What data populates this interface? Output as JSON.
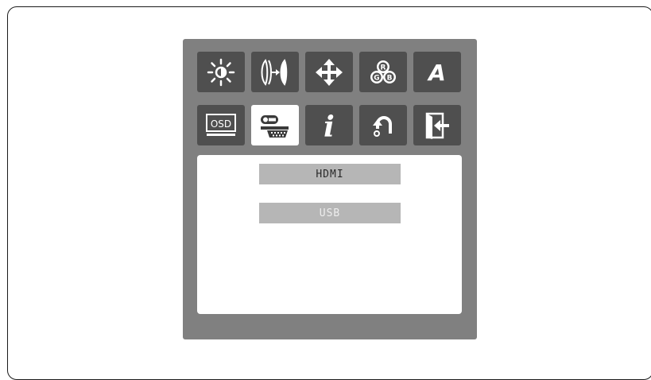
{
  "osd_menu": {
    "tabs_row1": [
      {
        "icon": "brightness-icon"
      },
      {
        "icon": "image-setup-icon"
      },
      {
        "icon": "position-icon"
      },
      {
        "icon": "color-rgb-icon"
      },
      {
        "icon": "font-a-icon",
        "glyph": "A"
      }
    ],
    "tabs_row2": [
      {
        "icon": "osd-icon",
        "glyph": "OSD"
      },
      {
        "icon": "input-source-icon",
        "selected": true
      },
      {
        "icon": "information-icon",
        "glyph": "i"
      },
      {
        "icon": "reset-icon"
      },
      {
        "icon": "exit-icon"
      }
    ],
    "rgb_letters": {
      "r": "R",
      "g": "G",
      "b": "B"
    },
    "sources": [
      {
        "label": "HDMI",
        "state": "active"
      },
      {
        "label": "USB",
        "state": "inactive"
      }
    ]
  },
  "colors": {
    "panel": "#808080",
    "tile": "#4f4f4f",
    "tile_selected": "#ffffff",
    "option_bar": "#b6b6b6"
  }
}
